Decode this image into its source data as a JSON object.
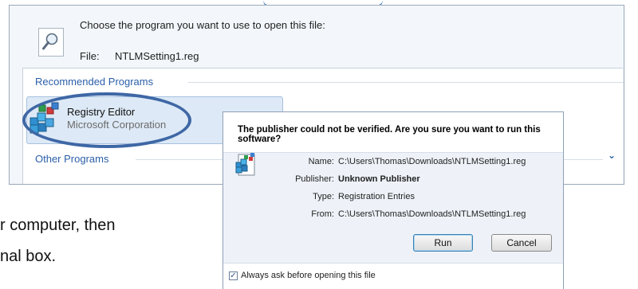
{
  "open_with": {
    "prompt": "Choose the program you want to use to open this file:",
    "file_label": "File:",
    "file_name": "NTLMSetting1.reg",
    "recommended_header": "Recommended Programs",
    "other_header": "Other Programs",
    "program": {
      "name": "Registry Editor",
      "vendor": "Microsoft Corporation",
      "icon": "registry-editor-icon"
    },
    "expand_glyph": "⌄"
  },
  "background_text": {
    "line1": "r computer, then",
    "line2": "nal box."
  },
  "security_warning": {
    "title": "The publisher could not be verified.  Are you sure you want to run this software?",
    "icon": "registry-file-icon",
    "fields": [
      {
        "label": "Name:",
        "value": "C:\\Users\\Thomas\\Downloads\\NTLMSetting1.reg",
        "bold": false
      },
      {
        "label": "Publisher:",
        "value": "Unknown Publisher",
        "bold": true
      },
      {
        "label": "Type:",
        "value": "Registration Entries",
        "bold": false
      },
      {
        "label": "From:",
        "value": "C:\\Users\\Thomas\\Downloads\\NTLMSetting1.reg",
        "bold": false
      }
    ],
    "run_label": "Run",
    "cancel_label": "Cancel",
    "always_ask_label": "Always ask before opening this file",
    "always_ask_checked": true,
    "checkmark": "✓"
  },
  "colors": {
    "accent": "#2b5fa9",
    "highlight_ring": "#3e67a5"
  }
}
